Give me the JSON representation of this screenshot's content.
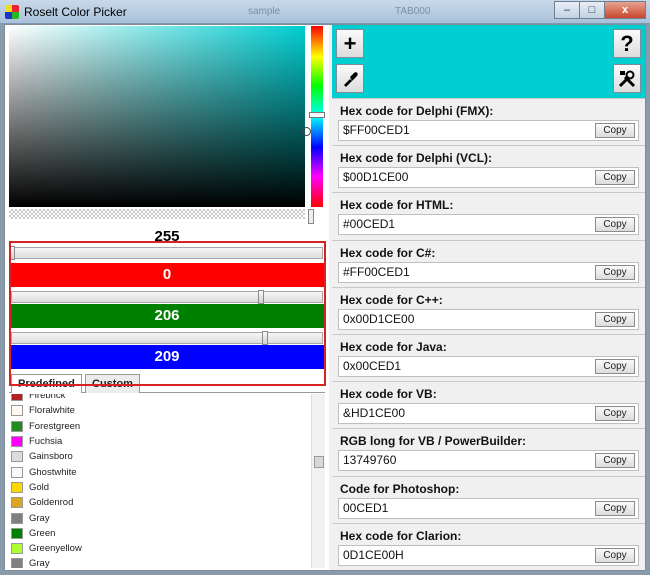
{
  "window": {
    "title": "Roselt Color Picker",
    "bg_tab_1": "sample",
    "bg_tab_2": "TAB000",
    "minimize": "–",
    "maximize": "□",
    "close": "x"
  },
  "color": {
    "alpha": "255",
    "red": "0",
    "green": "206",
    "blue": "209",
    "preview_hex": "#00CED1",
    "hue_base": "#00CED1"
  },
  "tabs": {
    "predefined": "Predefined",
    "custom": "Custom"
  },
  "predefined_colors": [
    {
      "name": "Firebrick",
      "hex": "#B22222"
    },
    {
      "name": "Floralwhite",
      "hex": "#FFFAF0"
    },
    {
      "name": "Forestgreen",
      "hex": "#228B22"
    },
    {
      "name": "Fuchsia",
      "hex": "#FF00FF"
    },
    {
      "name": "Gainsboro",
      "hex": "#DCDCDC"
    },
    {
      "name": "Ghostwhite",
      "hex": "#F8F8FF"
    },
    {
      "name": "Gold",
      "hex": "#FFD700"
    },
    {
      "name": "Goldenrod",
      "hex": "#DAA520"
    },
    {
      "name": "Gray",
      "hex": "#808080"
    },
    {
      "name": "Green",
      "hex": "#008000"
    },
    {
      "name": "Greenyellow",
      "hex": "#ADFF2F"
    },
    {
      "name": "Gray",
      "hex": "#808080"
    }
  ],
  "toolbar": {
    "add_icon": "plus-icon",
    "pick_icon": "eyedropper-icon",
    "help_icon": "question-icon",
    "settings_icon": "tools-icon"
  },
  "copy_label": "Copy",
  "codes": [
    {
      "label": "Hex code for Delphi (FMX):",
      "value": "$FF00CED1"
    },
    {
      "label": "Hex code for Delphi (VCL):",
      "value": "$00D1CE00"
    },
    {
      "label": "Hex code for HTML:",
      "value": "#00CED1"
    },
    {
      "label": "Hex code for C#:",
      "value": "#FF00CED1"
    },
    {
      "label": "Hex code for C++:",
      "value": "0x00D1CE00"
    },
    {
      "label": "Hex code for Java:",
      "value": "0x00CED1"
    },
    {
      "label": "Hex code for VB:",
      "value": "&HD1CE00"
    },
    {
      "label": "RGB long for VB / PowerBuilder:",
      "value": "13749760"
    },
    {
      "label": "Code for Photoshop:",
      "value": "00CED1"
    },
    {
      "label": "Hex code for Clarion:",
      "value": "0D1CE00H"
    }
  ]
}
